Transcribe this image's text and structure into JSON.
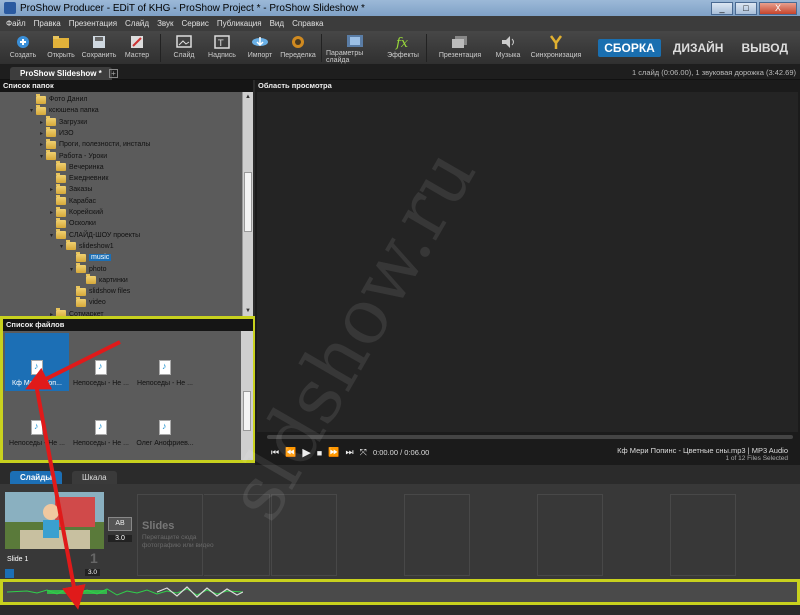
{
  "window": {
    "title": "ProShow Producer - EDiT of KHG - ProShow Project * - ProShow Slideshow *",
    "minimize": "_",
    "maximize": "□",
    "close": "X"
  },
  "menu": [
    "Файл",
    "Правка",
    "Презентация",
    "Слайд",
    "Звук",
    "Сервис",
    "Публикация",
    "Вид",
    "Справка"
  ],
  "toolbar": [
    {
      "label": "Создать",
      "icon": "create-icon"
    },
    {
      "label": "Открыть",
      "icon": "open-icon"
    },
    {
      "label": "Сохранить",
      "icon": "save-icon"
    },
    {
      "label": "Мастер",
      "icon": "wizard-icon"
    },
    {
      "label": "Слайд",
      "icon": "slide-icon"
    },
    {
      "label": "Надпись",
      "icon": "caption-icon"
    },
    {
      "label": "Импорт",
      "icon": "import-icon"
    },
    {
      "label": "Переделка",
      "icon": "remix-icon"
    },
    {
      "label": "Параметры слайда",
      "icon": "slide-options-icon"
    },
    {
      "label": "Эффекты",
      "icon": "effects-icon"
    },
    {
      "label": "Презентация",
      "icon": "presentation-icon"
    },
    {
      "label": "Музыка",
      "icon": "music-icon"
    },
    {
      "label": "Синхронизация",
      "icon": "sync-icon"
    }
  ],
  "modes": {
    "build": "СБОРКА",
    "design": "ДИЗАЙН",
    "publish": "ВЫВОД"
  },
  "tabs": {
    "project_tab": "ProShow Slideshow *",
    "add": "+"
  },
  "status": "1 слайд (0:06.00), 1 звуковая дорожка (3:42.69)",
  "folder_panel": {
    "header": "Список папок",
    "items": [
      {
        "label": "Фото Данил",
        "indent": 1,
        "arrow": ""
      },
      {
        "label": "ксюшена папка",
        "indent": 1,
        "arrow": "▾"
      },
      {
        "label": "Загрузки",
        "indent": 2,
        "arrow": "▸"
      },
      {
        "label": "ИЗО",
        "indent": 2,
        "arrow": "▸"
      },
      {
        "label": "Проги, полезности, инсталы",
        "indent": 2,
        "arrow": "▸"
      },
      {
        "label": "Работа - Уроки",
        "indent": 2,
        "arrow": "▾"
      },
      {
        "label": "Вечеринка",
        "indent": 3,
        "arrow": ""
      },
      {
        "label": "Ежедневник",
        "indent": 3,
        "arrow": ""
      },
      {
        "label": "Заказы",
        "indent": 3,
        "arrow": "▸"
      },
      {
        "label": "Карабас",
        "indent": 3,
        "arrow": ""
      },
      {
        "label": "Корейский",
        "indent": 3,
        "arrow": "▸"
      },
      {
        "label": "Осколки",
        "indent": 3,
        "arrow": ""
      },
      {
        "label": "СЛАЙД-ШОУ проекты",
        "indent": 3,
        "arrow": "▾"
      },
      {
        "label": "slideshow1",
        "indent": 4,
        "arrow": "▾"
      },
      {
        "label": "music",
        "indent": 5,
        "arrow": "",
        "selected": true
      },
      {
        "label": "photo",
        "indent": 5,
        "arrow": "▾"
      },
      {
        "label": "картинки",
        "indent": 6,
        "arrow": ""
      },
      {
        "label": "slidshow files",
        "indent": 5,
        "arrow": ""
      },
      {
        "label": "video",
        "indent": 5,
        "arrow": ""
      },
      {
        "label": "Сотмаркет",
        "indent": 3,
        "arrow": "▸"
      }
    ]
  },
  "files_panel": {
    "header": "Список файлов",
    "files": [
      {
        "label": "Кф Мери Поп...",
        "selected": true
      },
      {
        "label": "Непоседы - Не ..."
      },
      {
        "label": "Непоседы - Не ..."
      },
      {
        "label": "Непоседы - Не ..."
      },
      {
        "label": "Непоседы - Не ..."
      },
      {
        "label": "Олег Анофриев..."
      }
    ]
  },
  "preview": {
    "header": "Область просмотра",
    "timecode": "0:00.00 / 0:06.00",
    "track_name": "Кф Мери Попинс - Цветные сны.mp3  |  MP3 Audio",
    "file_count": "1 of 12 Files Selected"
  },
  "bottom_tabs": {
    "slides": "Слайды",
    "timeline": "Шкала"
  },
  "slide_list": {
    "slide_label": "Slide 1",
    "slide_number": "1",
    "slide_duration": "3.0",
    "transition_label": "AB",
    "transition_duration": "3.0",
    "placeholder_title": "Slides",
    "placeholder_hint": "Перетащите сюда фотографию или видео"
  },
  "watermark": "sldshow.ru",
  "colors": {
    "accent": "#1c6fb5",
    "highlight": "#c8d11e",
    "arrow": "#e01a1a"
  }
}
